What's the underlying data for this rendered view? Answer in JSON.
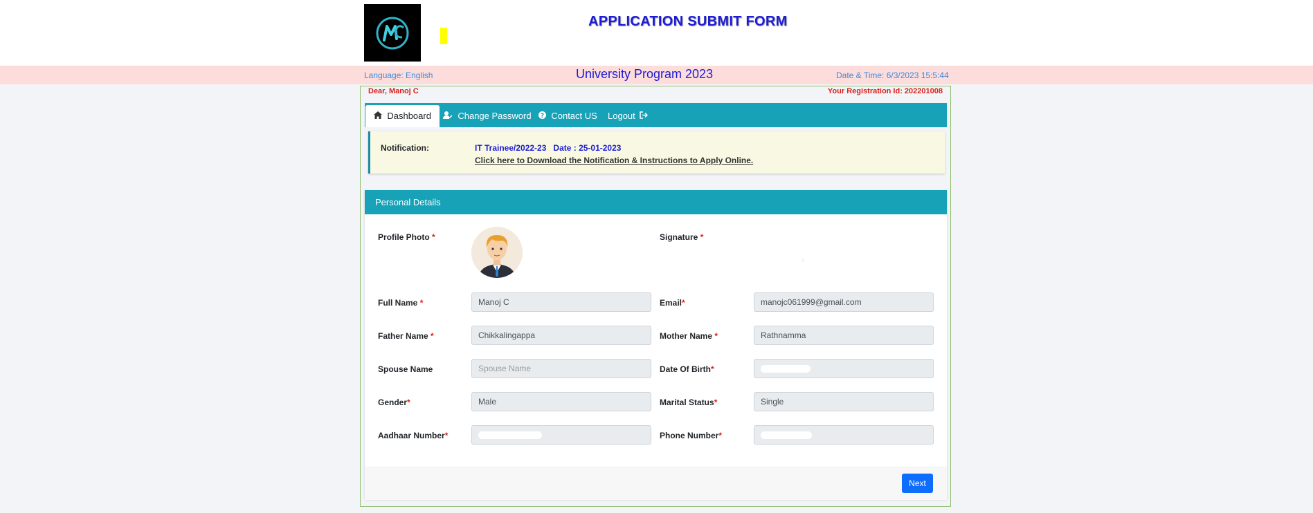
{
  "header": {
    "title": "APPLICATION SUBMIT FORM",
    "logo_icon": "mc-logo-icon"
  },
  "infobar": {
    "language": "Language: English",
    "program": "University Program 2023",
    "datetime": "Date & Time: 6/3/2023 15:5:44"
  },
  "user": {
    "dear": "Dear, Manoj C",
    "registration_label": "Your Registration Id: 202201008"
  },
  "nav": {
    "tabs": [
      {
        "label": "Dashboard",
        "icon": "home-icon"
      },
      {
        "label": "Change Password",
        "icon": "user-edit-icon"
      },
      {
        "label": "Contact US",
        "icon": "question-circle-icon"
      },
      {
        "label": "Logout",
        "icon": "sign-out-icon"
      }
    ]
  },
  "notification": {
    "label": "Notification:",
    "title": "IT Trainee/2022-23   Date : 25-01-2023",
    "link": "Click here to Download the Notification & Instructions to Apply Online."
  },
  "personal": {
    "heading": "Personal Details",
    "profile_photo_label": "Profile Photo",
    "signature_label": "Signature",
    "required_mark": "*",
    "fields": {
      "full_name": {
        "label": "Full Name",
        "value": "Manoj C"
      },
      "email": {
        "label": "Email",
        "value": "manojc061999@gmail.com"
      },
      "father_name": {
        "label": "Father Name",
        "value": "Chikkalingappa"
      },
      "mother_name": {
        "label": "Mother Name",
        "value": "Rathnamma"
      },
      "spouse_name": {
        "label": "Spouse Name",
        "placeholder": "Spouse Name"
      },
      "dob": {
        "label": "Date Of Birth"
      },
      "gender": {
        "label": "Gender",
        "value": "Male"
      },
      "marital_status": {
        "label": "Marital Status",
        "value": "Single"
      },
      "aadhaar": {
        "label": "Aadhaar Number"
      },
      "phone": {
        "label": "Phone Number"
      }
    },
    "next_label": "Next"
  },
  "colors": {
    "accent": "#17a2b8",
    "title_blue": "#1c1cd6",
    "error_red": "#d8221a",
    "infobar_bg": "#fddcdc",
    "primary_button": "#0d6efd"
  }
}
